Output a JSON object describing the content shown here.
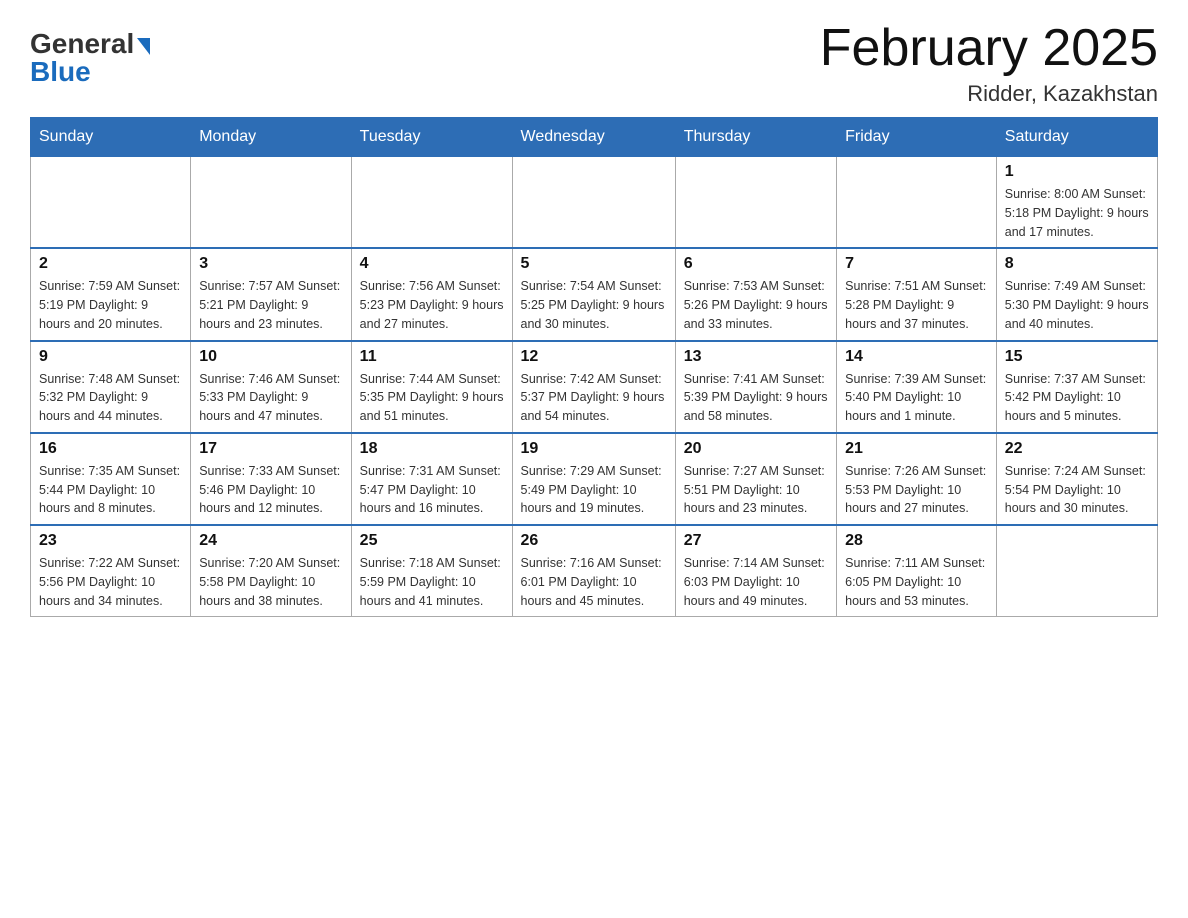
{
  "header": {
    "logo_general": "General",
    "logo_blue": "Blue",
    "month_title": "February 2025",
    "location": "Ridder, Kazakhstan"
  },
  "weekdays": [
    "Sunday",
    "Monday",
    "Tuesday",
    "Wednesday",
    "Thursday",
    "Friday",
    "Saturday"
  ],
  "weeks": [
    [
      {
        "day": "",
        "info": ""
      },
      {
        "day": "",
        "info": ""
      },
      {
        "day": "",
        "info": ""
      },
      {
        "day": "",
        "info": ""
      },
      {
        "day": "",
        "info": ""
      },
      {
        "day": "",
        "info": ""
      },
      {
        "day": "1",
        "info": "Sunrise: 8:00 AM\nSunset: 5:18 PM\nDaylight: 9 hours and 17 minutes."
      }
    ],
    [
      {
        "day": "2",
        "info": "Sunrise: 7:59 AM\nSunset: 5:19 PM\nDaylight: 9 hours and 20 minutes."
      },
      {
        "day": "3",
        "info": "Sunrise: 7:57 AM\nSunset: 5:21 PM\nDaylight: 9 hours and 23 minutes."
      },
      {
        "day": "4",
        "info": "Sunrise: 7:56 AM\nSunset: 5:23 PM\nDaylight: 9 hours and 27 minutes."
      },
      {
        "day": "5",
        "info": "Sunrise: 7:54 AM\nSunset: 5:25 PM\nDaylight: 9 hours and 30 minutes."
      },
      {
        "day": "6",
        "info": "Sunrise: 7:53 AM\nSunset: 5:26 PM\nDaylight: 9 hours and 33 minutes."
      },
      {
        "day": "7",
        "info": "Sunrise: 7:51 AM\nSunset: 5:28 PM\nDaylight: 9 hours and 37 minutes."
      },
      {
        "day": "8",
        "info": "Sunrise: 7:49 AM\nSunset: 5:30 PM\nDaylight: 9 hours and 40 minutes."
      }
    ],
    [
      {
        "day": "9",
        "info": "Sunrise: 7:48 AM\nSunset: 5:32 PM\nDaylight: 9 hours and 44 minutes."
      },
      {
        "day": "10",
        "info": "Sunrise: 7:46 AM\nSunset: 5:33 PM\nDaylight: 9 hours and 47 minutes."
      },
      {
        "day": "11",
        "info": "Sunrise: 7:44 AM\nSunset: 5:35 PM\nDaylight: 9 hours and 51 minutes."
      },
      {
        "day": "12",
        "info": "Sunrise: 7:42 AM\nSunset: 5:37 PM\nDaylight: 9 hours and 54 minutes."
      },
      {
        "day": "13",
        "info": "Sunrise: 7:41 AM\nSunset: 5:39 PM\nDaylight: 9 hours and 58 minutes."
      },
      {
        "day": "14",
        "info": "Sunrise: 7:39 AM\nSunset: 5:40 PM\nDaylight: 10 hours and 1 minute."
      },
      {
        "day": "15",
        "info": "Sunrise: 7:37 AM\nSunset: 5:42 PM\nDaylight: 10 hours and 5 minutes."
      }
    ],
    [
      {
        "day": "16",
        "info": "Sunrise: 7:35 AM\nSunset: 5:44 PM\nDaylight: 10 hours and 8 minutes."
      },
      {
        "day": "17",
        "info": "Sunrise: 7:33 AM\nSunset: 5:46 PM\nDaylight: 10 hours and 12 minutes."
      },
      {
        "day": "18",
        "info": "Sunrise: 7:31 AM\nSunset: 5:47 PM\nDaylight: 10 hours and 16 minutes."
      },
      {
        "day": "19",
        "info": "Sunrise: 7:29 AM\nSunset: 5:49 PM\nDaylight: 10 hours and 19 minutes."
      },
      {
        "day": "20",
        "info": "Sunrise: 7:27 AM\nSunset: 5:51 PM\nDaylight: 10 hours and 23 minutes."
      },
      {
        "day": "21",
        "info": "Sunrise: 7:26 AM\nSunset: 5:53 PM\nDaylight: 10 hours and 27 minutes."
      },
      {
        "day": "22",
        "info": "Sunrise: 7:24 AM\nSunset: 5:54 PM\nDaylight: 10 hours and 30 minutes."
      }
    ],
    [
      {
        "day": "23",
        "info": "Sunrise: 7:22 AM\nSunset: 5:56 PM\nDaylight: 10 hours and 34 minutes."
      },
      {
        "day": "24",
        "info": "Sunrise: 7:20 AM\nSunset: 5:58 PM\nDaylight: 10 hours and 38 minutes."
      },
      {
        "day": "25",
        "info": "Sunrise: 7:18 AM\nSunset: 5:59 PM\nDaylight: 10 hours and 41 minutes."
      },
      {
        "day": "26",
        "info": "Sunrise: 7:16 AM\nSunset: 6:01 PM\nDaylight: 10 hours and 45 minutes."
      },
      {
        "day": "27",
        "info": "Sunrise: 7:14 AM\nSunset: 6:03 PM\nDaylight: 10 hours and 49 minutes."
      },
      {
        "day": "28",
        "info": "Sunrise: 7:11 AM\nSunset: 6:05 PM\nDaylight: 10 hours and 53 minutes."
      },
      {
        "day": "",
        "info": ""
      }
    ]
  ]
}
